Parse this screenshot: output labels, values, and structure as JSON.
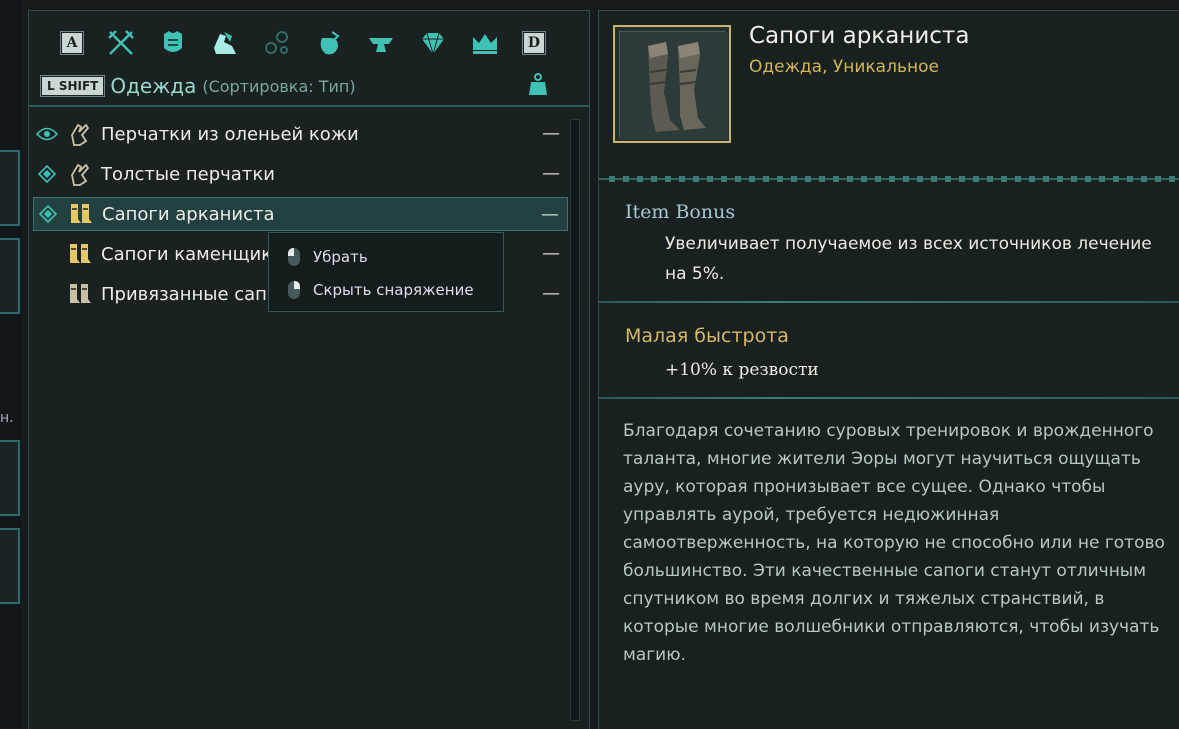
{
  "category_bar": {
    "left_key": "A",
    "right_key": "D",
    "icons": [
      "weapons-icon",
      "armor-icon",
      "clothing-icon",
      "jewelry-icon",
      "consumables-icon",
      "crafting-icon",
      "gems-icon",
      "treasure-icon"
    ]
  },
  "header": {
    "shift_key": "L SHIFT",
    "title": "Одежда",
    "sort": "(Сортировка: Тип)"
  },
  "items": [
    {
      "label": "Перчатки из оленьей кожи",
      "marker": "eye",
      "icon": "glove",
      "value": "—"
    },
    {
      "label": "Толстые перчатки",
      "marker": "diamond",
      "icon": "glove",
      "value": "—"
    },
    {
      "label": "Сапоги арканиста",
      "marker": "diamond",
      "icon": "boots-gold",
      "value": "—",
      "selected": true
    },
    {
      "label": "Сапоги каменщика",
      "marker": "",
      "icon": "boots-gold",
      "value": "—"
    },
    {
      "label": "Привязанные сапоги",
      "marker": "",
      "icon": "boots",
      "value": "—"
    }
  ],
  "context_menu": {
    "items": [
      {
        "label": "Убрать",
        "button": "left-mouse"
      },
      {
        "label": "Скрыть снаряжение",
        "button": "right-mouse"
      }
    ]
  },
  "detail": {
    "name": "Сапоги арканиста",
    "type": "Одежда, Уникальное",
    "bonus_title": "Item Bonus",
    "bonus_text": "Увеличивает получаемое из всех источников лечение на 5%.",
    "perk_title": "Малая быстрота",
    "perk_text": "+10% к резвости",
    "lore": "Благодаря сочетанию суровых тренировок и врожденного таланта, многие жители Эоры могут научиться ощущать ауру, которая пронизывает все сущее. Однако чтобы управлять аурой, требуется недюжинная самоотверженность, на которую не способно или не готово большинство. Эти качественные сапоги станут отличным спутником во время долгих и тяжелых странствий, в которые многие волшебники отправляются, чтобы изучать магию."
  },
  "left_edge": {
    "text": "н."
  },
  "colors": {
    "accent": "#3fc1b4",
    "gold": "#d3b55a",
    "panel_border": "#2c4d4c",
    "selected_row": "#22403f"
  }
}
